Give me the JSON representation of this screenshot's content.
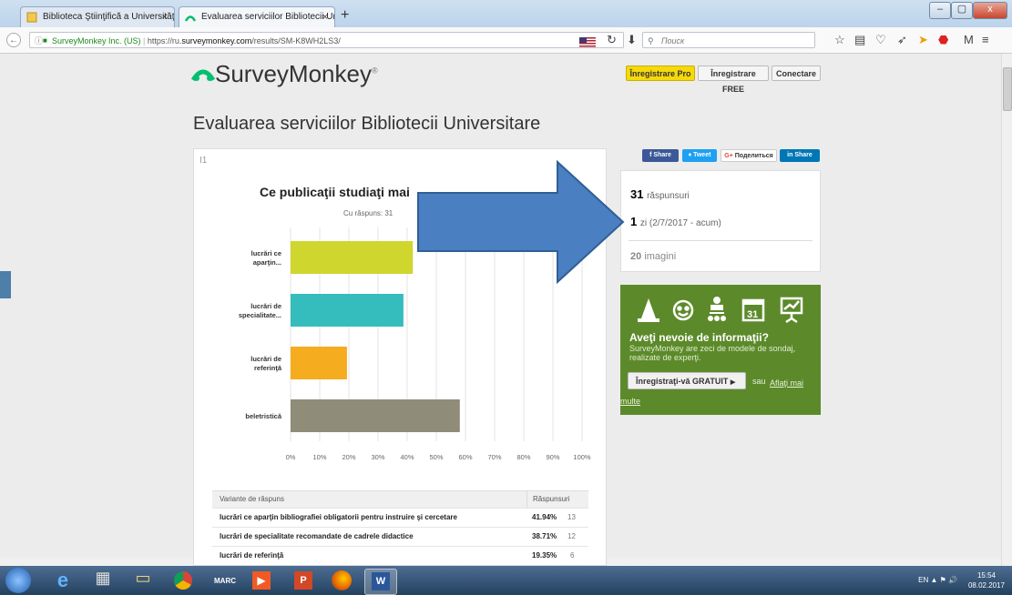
{
  "browser": {
    "tabs": [
      {
        "label": "Biblioteca Ştiinţifică a Universităţii ..."
      },
      {
        "label": "Evaluarea serviciilor Bibliotecii Uni..."
      }
    ],
    "url_identity": "SurveyMonkey Inc. (US)",
    "url_prefix": "https://ru.",
    "url_domain": "surveymonkey.com",
    "url_path": "/results/SM-K8WH2LS3/",
    "search_placeholder": "Поиск",
    "win_min": "–",
    "win_max": "▢",
    "win_close": "x",
    "tab_close": "×",
    "new_tab": "+"
  },
  "header": {
    "logo_text": "SurveyMonkey",
    "logo_reg": "®",
    "btn_pro": "Înregistrare Pro",
    "btn_free": "Înregistrare FREE",
    "btn_connect": "Conectare"
  },
  "page_title": "Evaluarea serviciilor Bibliotecii Universitare",
  "question": {
    "number": "I1",
    "title": "Ce publicaţii studiaţi mai",
    "answered": "Cu răspuns: 31"
  },
  "chart_data": {
    "type": "bar",
    "orientation": "horizontal",
    "title": "Ce publicaţii studiaţi mai",
    "categories": [
      [
        "lucrări ce",
        "aparţin..."
      ],
      [
        "lucrări de",
        "specialitate..."
      ],
      [
        "lucrări de",
        "referinţă"
      ],
      [
        "beletristică"
      ]
    ],
    "values": [
      41.94,
      38.71,
      19.35,
      58.06
    ],
    "colors": [
      "#cfd62e",
      "#35bcbd",
      "#f5ac1f",
      "#8f8c7a"
    ],
    "xlim": [
      0,
      100
    ],
    "xticks": [
      "0%",
      "10%",
      "20%",
      "30%",
      "40%",
      "50%",
      "60%",
      "70%",
      "80%",
      "90%",
      "100%"
    ],
    "grid": true
  },
  "table": {
    "col_option": "Variante de răspuns",
    "col_responses": "Răspunsuri",
    "rows": [
      {
        "label": "lucrări ce aparţin bibliografiei obligatorii pentru instruire şi cercetare",
        "pct": "41.94%",
        "count": "13"
      },
      {
        "label": "lucrări de specialitate recomandate de cadrele didactice",
        "pct": "38.71%",
        "count": "12"
      },
      {
        "label": "lucrări de referinţă",
        "pct": "19.35%",
        "count": "6"
      }
    ]
  },
  "share": {
    "facebook": "Share",
    "twitter": "Tweet",
    "google": "Поделиться",
    "linkedin": "Share"
  },
  "stats": {
    "responses_num": "31",
    "responses_label": "răspunsuri",
    "days_num": "1",
    "days_label": "zi (2/7/2017 - acum)",
    "images_num": "20",
    "images_label": "imagini"
  },
  "promo": {
    "heading": "Aveţi nevoie de informaţii?",
    "text": "SurveyMonkey are zeci de modele de sondaj, realizate de experţi.",
    "button": "Înregistraţi-vă GRATUIT",
    "or": "sau",
    "link": "Aflaţi mai multe",
    "calendar_day": "31"
  },
  "taskbar": {
    "lang": "EN",
    "time": "15:54",
    "date": "08.02.2017",
    "app_marc": "MARC"
  },
  "colors": {
    "accent": "#5c8a2a",
    "arrow": "#4a7fc1",
    "pro_button": "#f5d90a"
  }
}
